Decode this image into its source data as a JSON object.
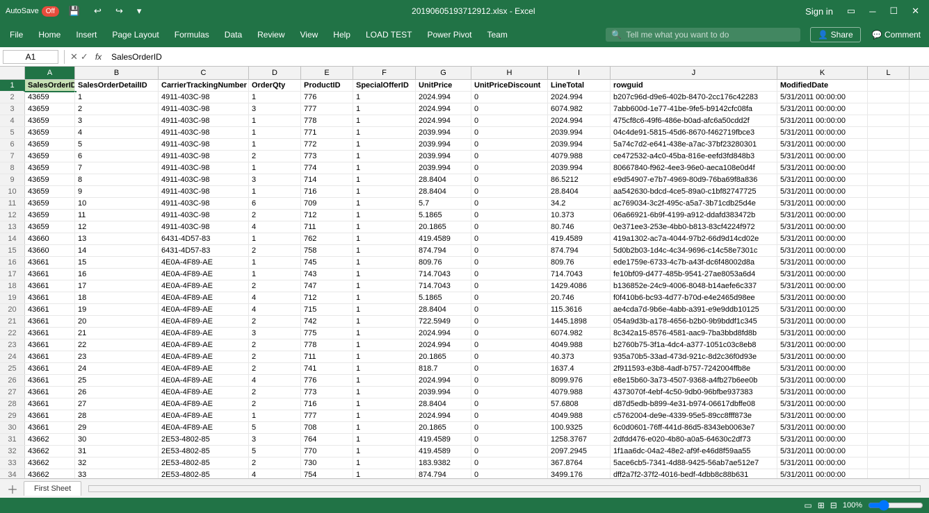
{
  "titleBar": {
    "autosave": "AutoSave",
    "autosaveState": "Off",
    "filename": "20190605193712912.xlsx - Excel",
    "signIn": "Sign in"
  },
  "menuBar": {
    "items": [
      "File",
      "Home",
      "Insert",
      "Page Layout",
      "Formulas",
      "Data",
      "Review",
      "View",
      "Help",
      "LOAD TEST",
      "Power Pivot",
      "Team"
    ],
    "searchPlaceholder": "Tell me what you want to do",
    "share": "Share",
    "comment": "Comment"
  },
  "formulaBar": {
    "cellRef": "A1",
    "formula": "SalesOrderID"
  },
  "columns": [
    {
      "id": "A",
      "label": "A",
      "header": "SalesOrderID"
    },
    {
      "id": "B",
      "label": "B",
      "header": "SalesOrderDetailID"
    },
    {
      "id": "C",
      "label": "C",
      "header": "CarrierTrackingNumber"
    },
    {
      "id": "D",
      "label": "D",
      "header": "OrderQty"
    },
    {
      "id": "E",
      "label": "E",
      "header": "ProductID"
    },
    {
      "id": "F",
      "label": "F",
      "header": "SpecialOfferID"
    },
    {
      "id": "G",
      "label": "G",
      "header": "UnitPrice"
    },
    {
      "id": "H",
      "label": "H",
      "header": "UnitPriceDiscount"
    },
    {
      "id": "I",
      "label": "I",
      "header": "LineTotal"
    },
    {
      "id": "J",
      "label": "J",
      "header": "rowguid"
    },
    {
      "id": "K",
      "label": "K",
      "header": "ModifiedDate"
    },
    {
      "id": "L",
      "label": "L",
      "header": ""
    }
  ],
  "rows": [
    [
      43659,
      1,
      "4911-403C-98",
      1,
      776,
      1,
      2024.994,
      0.0,
      2024.994,
      "b207c96d-d9e6-402b-8470-2cc176c42283",
      "5/31/2011 00:00:00"
    ],
    [
      43659,
      2,
      "4911-403C-98",
      3,
      777,
      1,
      2024.994,
      0.0,
      6074.982,
      "7abb600d-1e77-41be-9fe5-b9142cfc08fa",
      "5/31/2011 00:00:00"
    ],
    [
      43659,
      3,
      "4911-403C-98",
      1,
      778,
      1,
      2024.994,
      0.0,
      2024.994,
      "475cf8c6-49f6-486e-b0ad-afc6a50cdd2f",
      "5/31/2011 00:00:00"
    ],
    [
      43659,
      4,
      "4911-403C-98",
      1,
      771,
      1,
      2039.994,
      0.0,
      2039.994,
      "04c4de91-5815-45d6-8670-f462719fbce3",
      "5/31/2011 00:00:00"
    ],
    [
      43659,
      5,
      "4911-403C-98",
      1,
      772,
      1,
      2039.994,
      0.0,
      2039.994,
      "5a74c7d2-e641-438e-a7ac-37bf23280301",
      "5/31/2011 00:00:00"
    ],
    [
      43659,
      6,
      "4911-403C-98",
      2,
      773,
      1,
      2039.994,
      0.0,
      4079.988,
      "ce472532-a4c0-45ba-816e-eefd3fd848b3",
      "5/31/2011 00:00:00"
    ],
    [
      43659,
      7,
      "4911-403C-98",
      1,
      774,
      1,
      2039.994,
      0.0,
      2039.994,
      "80667840-f962-4ee3-96e0-aeca108e0d4f",
      "5/31/2011 00:00:00"
    ],
    [
      43659,
      8,
      "4911-403C-98",
      3,
      714,
      1,
      28.8404,
      0.0,
      86.5212,
      "e9d54907-e7b7-4969-80d9-76ba69f8a836",
      "5/31/2011 00:00:00"
    ],
    [
      43659,
      9,
      "4911-403C-98",
      1,
      716,
      1,
      28.8404,
      0.0,
      28.8404,
      "aa542630-bdcd-4ce5-89a0-c1bf82747725",
      "5/31/2011 00:00:00"
    ],
    [
      43659,
      10,
      "4911-403C-98",
      6,
      709,
      1,
      5.7,
      0.0,
      34.2,
      "ac769034-3c2f-495c-a5a7-3b71cdb25d4e",
      "5/31/2011 00:00:00"
    ],
    [
      43659,
      11,
      "4911-403C-98",
      2,
      712,
      1,
      5.1865,
      0.0,
      10.373,
      "06a66921-6b9f-4199-a912-ddafd383472b",
      "5/31/2011 00:00:00"
    ],
    [
      43659,
      12,
      "4911-403C-98",
      4,
      711,
      1,
      20.1865,
      0.0,
      80.746,
      "0e371ee3-253e-4bb0-b813-83cf4224f972",
      "5/31/2011 00:00:00"
    ],
    [
      43660,
      13,
      "6431-4D57-83",
      1,
      762,
      1,
      419.4589,
      0.0,
      419.4589,
      "419a1302-ac7a-4044-97b2-66d9d14cd02e",
      "5/31/2011 00:00:00"
    ],
    [
      43660,
      14,
      "6431-4D57-83",
      2,
      758,
      1,
      874.794,
      0.0,
      874.794,
      "5d0b2b03-1d4c-4c34-9696-c14c58e7301c",
      "5/31/2011 00:00:00"
    ],
    [
      43661,
      15,
      "4E0A-4F89-AE",
      1,
      745,
      1,
      809.76,
      0.0,
      809.76,
      "ede1759e-6733-4c7b-a43f-dc6f48002d8a",
      "5/31/2011 00:00:00"
    ],
    [
      43661,
      16,
      "4E0A-4F89-AE",
      1,
      743,
      1,
      714.7043,
      0.0,
      714.7043,
      "fe10bf09-d477-485b-9541-27ae8053a6d4",
      "5/31/2011 00:00:00"
    ],
    [
      43661,
      17,
      "4E0A-4F89-AE",
      2,
      747,
      1,
      714.7043,
      0.0,
      1429.4086,
      "b136852e-24c9-4006-8048-b14aefe6c337",
      "5/31/2011 00:00:00"
    ],
    [
      43661,
      18,
      "4E0A-4F89-AE",
      4,
      712,
      1,
      5.1865,
      0.0,
      20.746,
      "f0f410b6-bc93-4d77-b70d-e4e2465d98ee",
      "5/31/2011 00:00:00"
    ],
    [
      43661,
      19,
      "4E0A-4F89-AE",
      4,
      715,
      1,
      28.8404,
      0.0,
      115.3616,
      "ae4cda7d-9b6e-4abb-a391-e9e9ddb10125",
      "5/31/2011 00:00:00"
    ],
    [
      43661,
      20,
      "4E0A-4F89-AE",
      2,
      742,
      1,
      722.5949,
      0.0,
      1445.1898,
      "054a9d3b-a178-4656-b2b0-9b9bddf1c345",
      "5/31/2011 00:00:00"
    ],
    [
      43661,
      21,
      "4E0A-4F89-AE",
      3,
      775,
      1,
      2024.994,
      0.0,
      6074.982,
      "8c342a15-8576-4581-aac9-7ba3bbd8fd8b",
      "5/31/2011 00:00:00"
    ],
    [
      43661,
      22,
      "4E0A-4F89-AE",
      2,
      778,
      1,
      2024.994,
      0.0,
      4049.988,
      "b2760b75-3f1a-4dc4-a377-1051c03c8eb8",
      "5/31/2011 00:00:00"
    ],
    [
      43661,
      23,
      "4E0A-4F89-AE",
      2,
      711,
      1,
      20.1865,
      0.0,
      40.373,
      "935a70b5-33ad-473d-921c-8d2c36f0d93e",
      "5/31/2011 00:00:00"
    ],
    [
      43661,
      24,
      "4E0A-4F89-AE",
      2,
      741,
      1,
      818.7,
      0.0,
      1637.4,
      "2f911593-e3b8-4adf-b757-7242004ffb8e",
      "5/31/2011 00:00:00"
    ],
    [
      43661,
      25,
      "4E0A-4F89-AE",
      4,
      776,
      1,
      2024.994,
      0.0,
      8099.976,
      "e8e15b60-3a73-4507-9368-a4fb27b6ee0b",
      "5/31/2011 00:00:00"
    ],
    [
      43661,
      26,
      "4E0A-4F89-AE",
      2,
      773,
      1,
      2039.994,
      0.0,
      4079.988,
      "4373070f-4ebf-4c50-9db0-96bfbe937383",
      "5/31/2011 00:00:00"
    ],
    [
      43661,
      27,
      "4E0A-4F89-AE",
      2,
      716,
      1,
      28.8404,
      0.0,
      57.6808,
      "d87d5edb-b899-4e31-b974-06617dbffe08",
      "5/31/2011 00:00:00"
    ],
    [
      43661,
      28,
      "4E0A-4F89-AE",
      1,
      777,
      1,
      2024.994,
      0.0,
      4049.988,
      "c5762004-de9e-4339-95e5-89cc8fff873e",
      "5/31/2011 00:00:00"
    ],
    [
      43661,
      29,
      "4E0A-4F89-AE",
      5,
      708,
      1,
      20.1865,
      0.0,
      100.9325,
      "6c0d0601-76ff-441d-86d5-8343eb0063e7",
      "5/31/2011 00:00:00"
    ],
    [
      43662,
      30,
      "2E53-4802-85",
      3,
      764,
      1,
      419.4589,
      0.0,
      1258.3767,
      "2dfdd476-e020-4b80-a0a5-64630c2df73",
      "5/31/2011 00:00:00"
    ],
    [
      43662,
      31,
      "2E53-4802-85",
      5,
      770,
      1,
      419.4589,
      0.0,
      2097.2945,
      "1f1aa6dc-04a2-48e2-af9f-e46d8f59aa55",
      "5/31/2011 00:00:00"
    ],
    [
      43662,
      32,
      "2E53-4802-85",
      2,
      730,
      1,
      183.9382,
      0.0,
      367.8764,
      "5ace6cb5-7341-4d88-9425-56ab7ae512e7",
      "5/31/2011 00:00:00"
    ],
    [
      43662,
      33,
      "2E53-4802-85",
      4,
      754,
      1,
      874.794,
      0.0,
      3499.176,
      "dff2a7f2-37f2-4016-bedf-4dbb8c88b631",
      "5/31/2011 00:00:00"
    ]
  ],
  "sheets": [
    "First Sheet"
  ],
  "status": {
    "zoom": "100%"
  }
}
